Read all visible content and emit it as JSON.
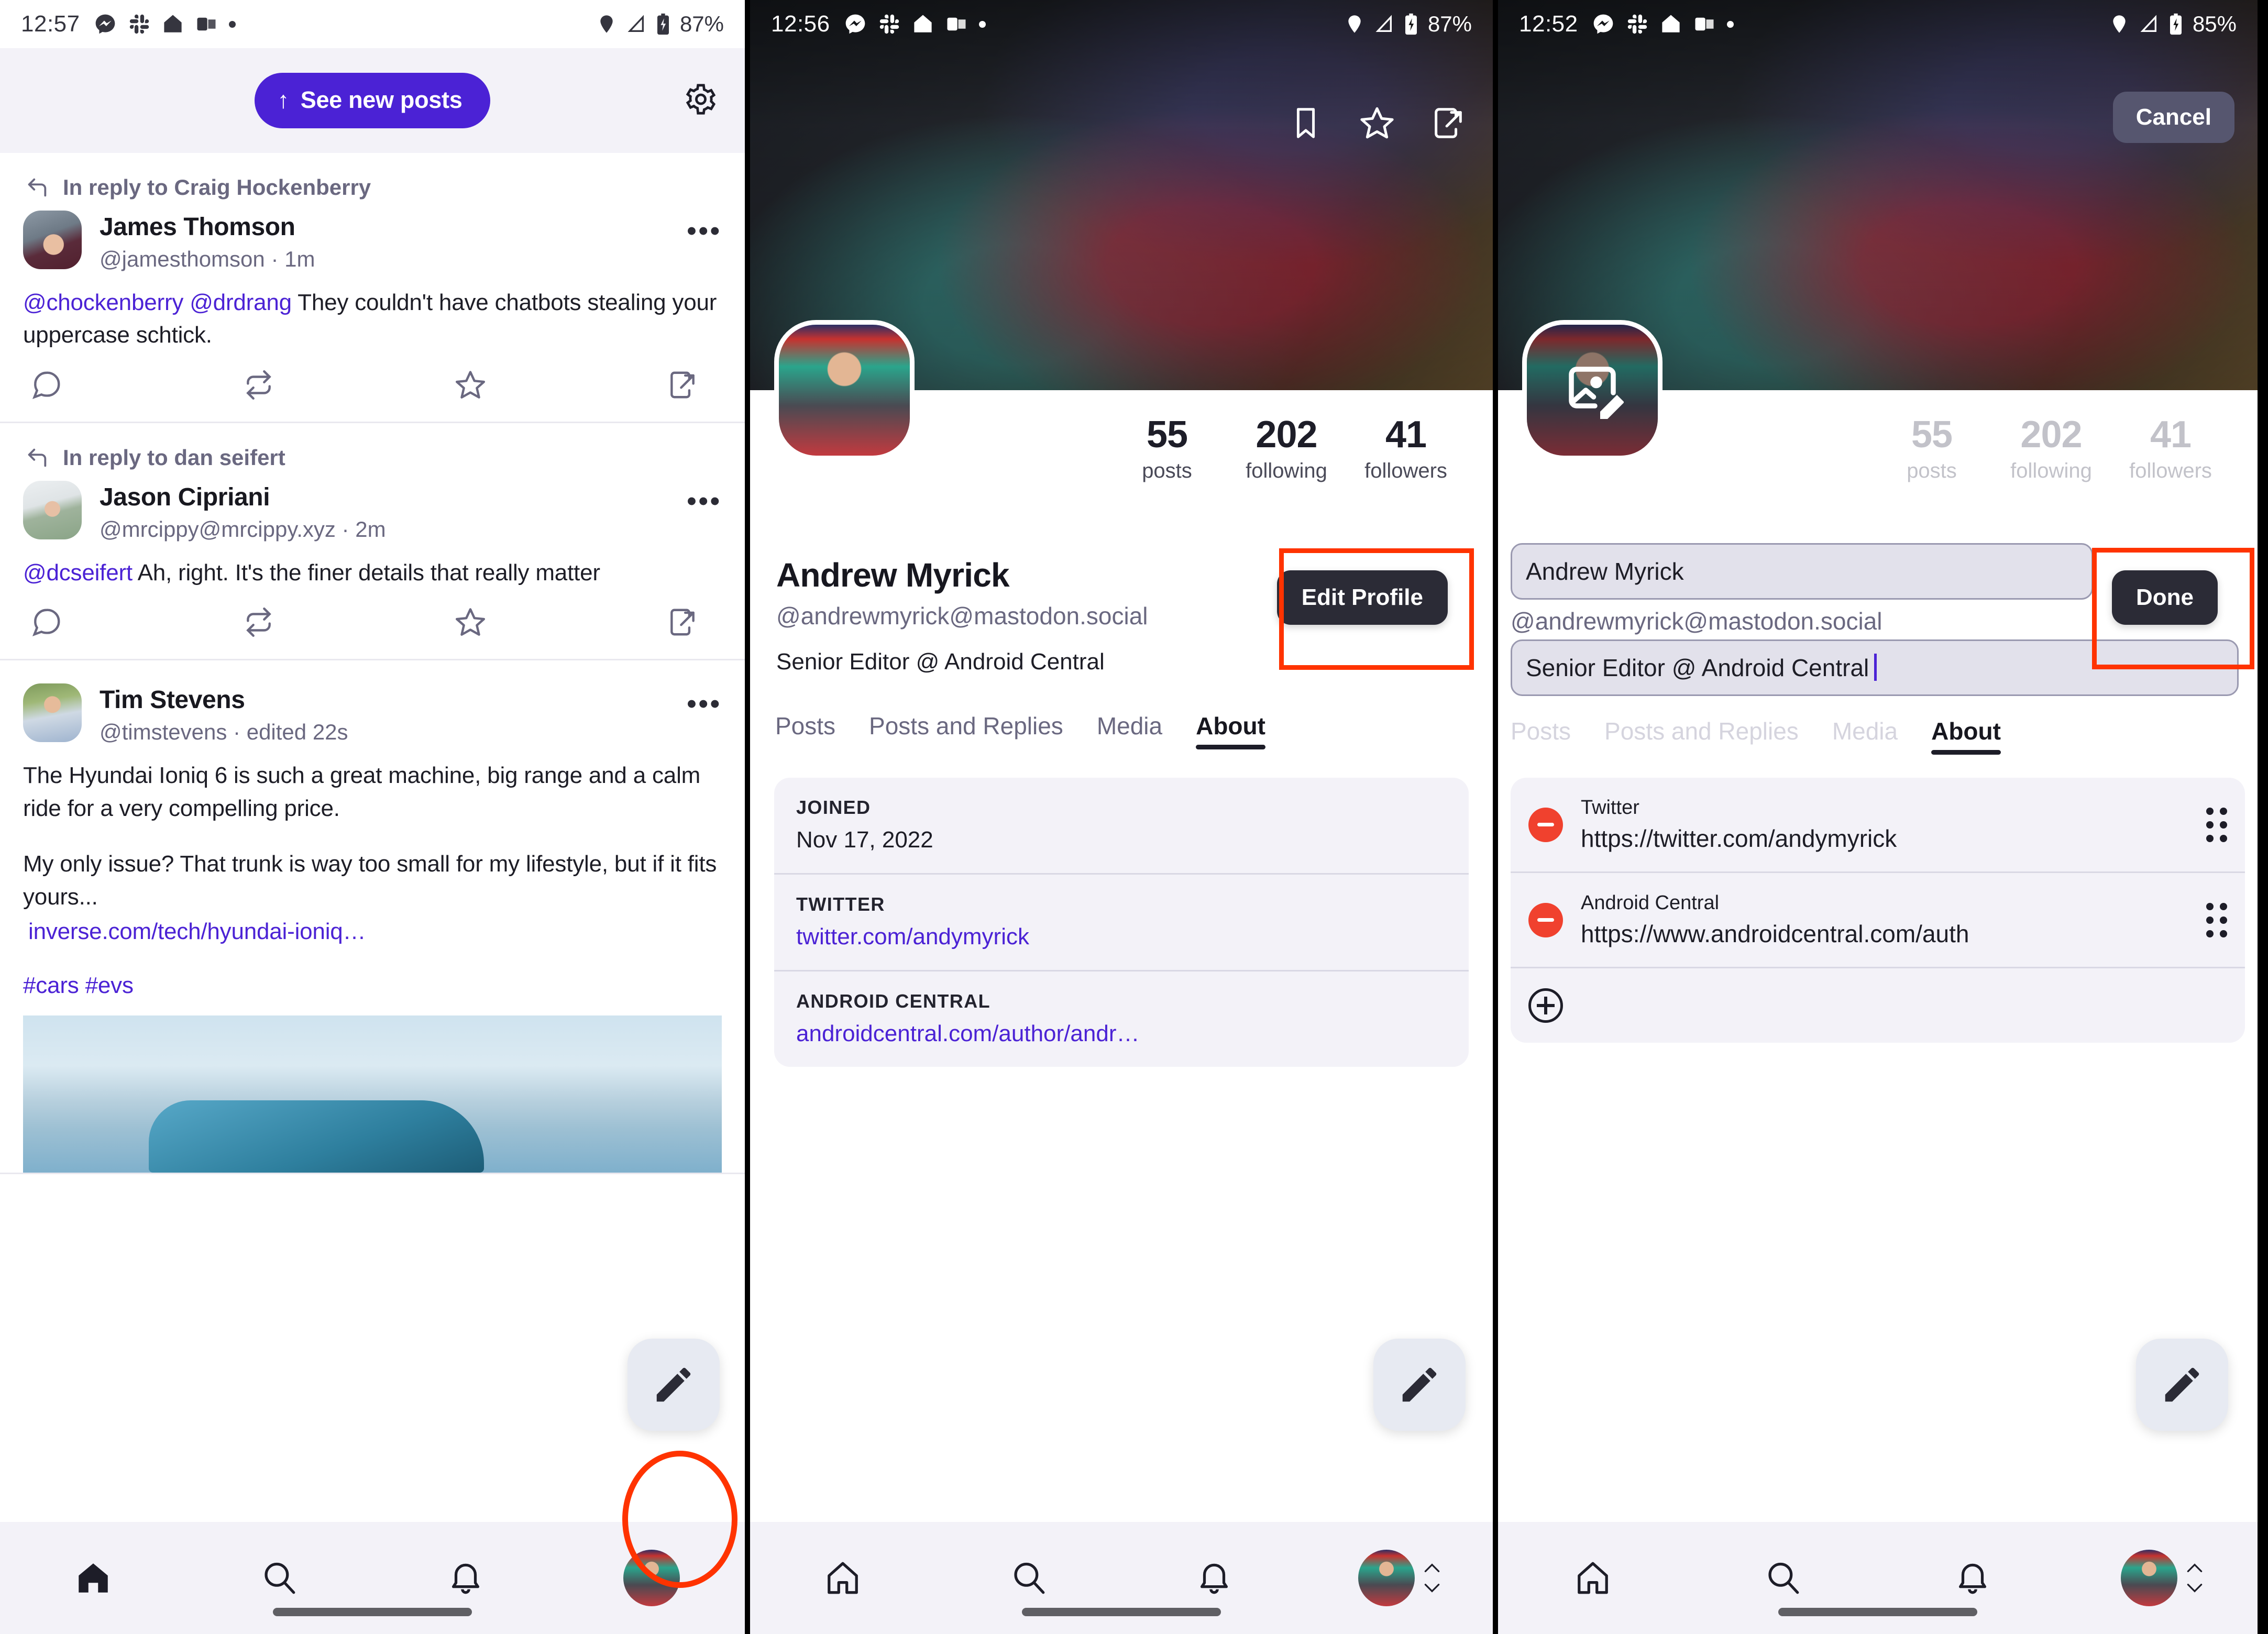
{
  "panel1": {
    "status": {
      "time": "12:57",
      "battery": "87%",
      "icons": [
        "messenger-icon",
        "slack-icon",
        "home-assistant-icon",
        "outlook-icon",
        "dot-icon"
      ],
      "right_icons": [
        "location-icon",
        "wifi-icon",
        "signal-icon",
        "battery-charging-icon"
      ]
    },
    "topbar": {
      "see_new_posts": "See new posts",
      "settings_icon": "gear-icon",
      "up_arrow": "↑"
    },
    "posts": [
      {
        "reply_to": "In reply to Craig Hockenberry",
        "name": "James Thomson",
        "handle": "@jamesthomson",
        "separator": "·",
        "time": "1m",
        "mentions": "@chockenberry @drdrang",
        "body": " They couldn't have chatbots stealing your uppercase schtick."
      },
      {
        "reply_to": "In reply to dan seifert",
        "name": "Jason Cipriani",
        "handle": "@mrcippy@mrcippy.xyz",
        "separator": "·",
        "time": "2m",
        "mentions": "@dcseifert",
        "body": " Ah, right. It's the finer details that really matter"
      },
      {
        "reply_to": "",
        "name": "Tim Stevens",
        "handle": "@timstevens",
        "separator": "·",
        "time": "edited 22s",
        "para1": "The Hyundai Ioniq 6 is such a great machine, big range and a calm ride for a very compelling price.",
        "para2": "My only issue? That trunk is way too small for my lifestyle, but if it fits yours...",
        "link": "inverse.com/tech/hyundai-ioniq…",
        "tags": "#cars #evs"
      }
    ],
    "post_actions": [
      "reply-icon",
      "boost-icon",
      "favorite-icon",
      "share-icon"
    ],
    "fab": "compose-pencil-icon",
    "nav": [
      "home-icon",
      "search-icon",
      "notifications-icon",
      "profile-avatar"
    ]
  },
  "panel2": {
    "status": {
      "time": "12:56",
      "battery": "87%"
    },
    "banner_actions": [
      "bookmark-icon",
      "favorite-star-icon",
      "share-icon"
    ],
    "stats": [
      {
        "num": "55",
        "label": "posts"
      },
      {
        "num": "202",
        "label": "following"
      },
      {
        "num": "41",
        "label": "followers"
      }
    ],
    "name": "Andrew Myrick",
    "handle": "@andrewmyrick@mastodon.social",
    "bio": "Senior Editor @ Android Central",
    "edit_profile": "Edit Profile",
    "tabs": [
      {
        "label": "Posts",
        "active": false
      },
      {
        "label": "Posts and Replies",
        "active": false
      },
      {
        "label": "Media",
        "active": false
      },
      {
        "label": "About",
        "active": true
      }
    ],
    "about_rows": [
      {
        "label": "JOINED",
        "value": "Nov 17, 2022",
        "is_link": false
      },
      {
        "label": "TWITTER",
        "value": "twitter.com/andymyrick",
        "is_link": true
      },
      {
        "label": "ANDROID CENTRAL",
        "value": "androidcentral.com/author/andr…",
        "is_link": true
      }
    ],
    "fab": "compose-pencil-icon",
    "nav": [
      "home-icon",
      "search-icon",
      "notifications-icon",
      "profile-avatar",
      "account-switch-chevrons"
    ]
  },
  "panel3": {
    "status": {
      "time": "12:52",
      "battery": "85%"
    },
    "cancel": "Cancel",
    "avatar_overlay_icon": "image-edit-icon",
    "stats": [
      {
        "num": "55",
        "label": "posts"
      },
      {
        "num": "202",
        "label": "following"
      },
      {
        "num": "41",
        "label": "followers"
      }
    ],
    "name_field_value": "Andrew Myrick",
    "handle": "@andrewmyrick@mastodon.social",
    "bio_field_value": "Senior Editor @ Android Central",
    "done": "Done",
    "tabs": [
      {
        "label": "Posts",
        "active": false
      },
      {
        "label": "Posts and Replies",
        "active": false
      },
      {
        "label": "Media",
        "active": false
      },
      {
        "label": "About",
        "active": true
      }
    ],
    "links": [
      {
        "title": "Twitter",
        "url": "https://twitter.com/andymyrick"
      },
      {
        "title": "Android Central",
        "url": "https://www.androidcentral.com/auth"
      }
    ],
    "add_link_icon": "plus-circle-icon",
    "fab": "compose-pencil-icon",
    "nav": [
      "home-icon",
      "search-icon",
      "notifications-icon",
      "profile-avatar",
      "account-switch-chevrons"
    ]
  },
  "colors": {
    "accent_purple": "#4b22d5",
    "highlight_red": "#ff3300",
    "dark_button": "#2b2b36",
    "cancel_button": "#56566f",
    "remove_red": "#f0412e",
    "surface": "#f3f2f8"
  }
}
